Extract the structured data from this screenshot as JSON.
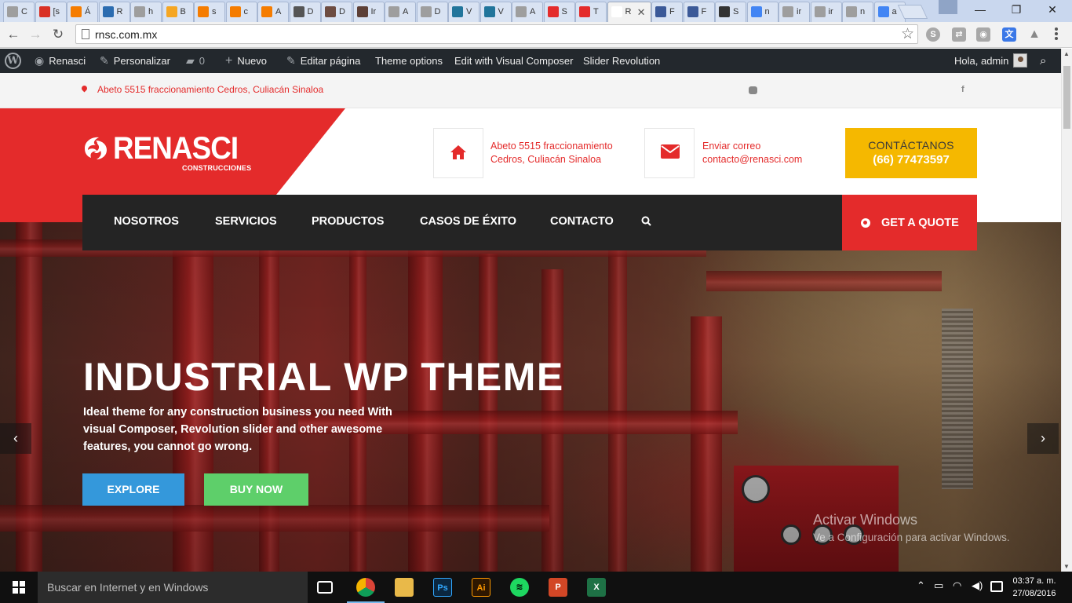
{
  "browser": {
    "tabs": [
      {
        "title": "C",
        "icon_color": "#9e9e9e"
      },
      {
        "title": "[s",
        "icon_color": "#d93025"
      },
      {
        "title": "Á",
        "icon_color": "#f57c00"
      },
      {
        "title": "R",
        "icon_color": "#2b6cb0"
      },
      {
        "title": "h",
        "icon_color": "#9e9e9e"
      },
      {
        "title": "B",
        "icon_color": "#f5a623"
      },
      {
        "title": "s",
        "icon_color": "#f57c00"
      },
      {
        "title": "c",
        "icon_color": "#f57c00"
      },
      {
        "title": "A",
        "icon_color": "#f57c00"
      },
      {
        "title": "D",
        "icon_color": "#555555"
      },
      {
        "title": "D",
        "icon_color": "#6d4c41"
      },
      {
        "title": "Ir",
        "icon_color": "#5d4037"
      },
      {
        "title": "A",
        "icon_color": "#9e9e9e"
      },
      {
        "title": "D",
        "icon_color": "#9e9e9e"
      },
      {
        "title": "V",
        "icon_color": "#21759b"
      },
      {
        "title": "V",
        "icon_color": "#21759b"
      },
      {
        "title": "A",
        "icon_color": "#9e9e9e"
      },
      {
        "title": "S",
        "icon_color": "#e42b2b"
      },
      {
        "title": "T",
        "icon_color": "#e42b2b"
      },
      {
        "title": "R",
        "icon_color": "#ffffff"
      },
      {
        "title": "F",
        "icon_color": "#3b5998"
      },
      {
        "title": "F",
        "icon_color": "#3b5998"
      },
      {
        "title": "S",
        "icon_color": "#333333"
      },
      {
        "title": "n",
        "icon_color": "#4285f4"
      },
      {
        "title": "ir",
        "icon_color": "#9e9e9e"
      },
      {
        "title": "ir",
        "icon_color": "#9e9e9e"
      },
      {
        "title": "n",
        "icon_color": "#9e9e9e"
      },
      {
        "title": "a",
        "icon_color": "#4285f4"
      }
    ],
    "active_tab_close": "✕",
    "url": "rnsc.com.mx",
    "window_controls": {
      "minimize": "—",
      "restore": "❐",
      "close": "✕"
    }
  },
  "wp_admin_bar": {
    "site_name": "Renasci",
    "customize": "Personalizar",
    "comments_count": "0",
    "new": "Nuevo",
    "edit_page": "Editar página",
    "theme_options": "Theme options",
    "visual_composer": "Edit with Visual Composer",
    "slider_revolution": "Slider Revolution",
    "greeting": "Hola, admin"
  },
  "topbar": {
    "address": "Abeto 5515 fraccionamiento Cedros, Culiacán Sinaloa",
    "social_icons": [
      "foursquare-icon",
      "facebook-icon"
    ]
  },
  "header": {
    "logo_text": "RENASCI",
    "logo_sub": "CONSTRUCCIONES",
    "address_line1": "Abeto 5515 fraccionamiento",
    "address_line2": "Cedros, Culiacán Sinaloa",
    "email_line1": "Enviar correo",
    "email_line2": "contacto@renasci.com",
    "contact_label": "CONTÁCTANOS",
    "contact_phone": "(66) 77473597"
  },
  "nav": {
    "items": [
      "NOSOTROS",
      "SERVICIOS",
      "PRODUCTOS",
      "CASOS DE ÉXITO",
      "CONTACTO"
    ],
    "quote": "GET A QUOTE"
  },
  "hero": {
    "title": "INDUSTRIAL WP THEME",
    "description": "Ideal theme for any construction business you need With visual Composer, Revolution slider and other awesome features, you cannot go wrong.",
    "explore": "EXPLORE",
    "buy": "BUY NOW",
    "prev": "‹",
    "next": "›"
  },
  "watermark": {
    "line1": "Activar Windows",
    "line2": "Ve a Configuración para activar Windows."
  },
  "taskbar": {
    "search_placeholder": "Buscar en Internet y en Windows",
    "time": "03:37 a. m.",
    "date": "27/08/2016"
  },
  "colors": {
    "brand_red": "#e42b2b",
    "brand_yellow": "#f5b800",
    "nav_dark": "#242424",
    "explore_blue": "#3498db",
    "buy_green": "#5ecf6a"
  }
}
